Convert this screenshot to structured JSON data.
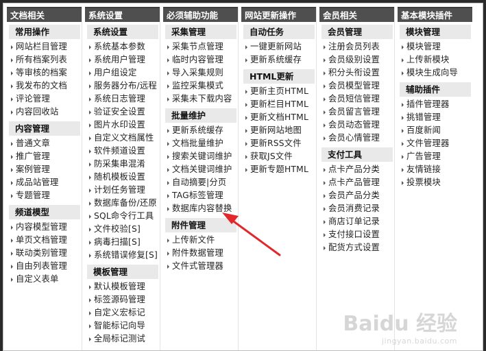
{
  "columns": [
    {
      "header": "文档相关",
      "groups": [
        {
          "title": "常用操作",
          "items": [
            "网站栏目管理",
            "所有档案列表",
            "等审核的档案",
            "我发布的文档",
            "评论管理",
            "内容回收站"
          ]
        },
        {
          "title": "内容管理",
          "items": [
            "普通文章",
            "推广管理",
            "案例管理",
            "成品站管理",
            "专题管理"
          ]
        },
        {
          "title": "频道模型",
          "items": [
            "内容模型管理",
            "单页文档管理",
            "联动类别管理",
            "自由列表管理",
            "自定义表单"
          ]
        }
      ]
    },
    {
      "header": "系统设置",
      "groups": [
        {
          "title": "系统设置",
          "items": [
            "系统基本参数",
            "系统用户管理",
            "用户组设定",
            "服务器分布/远程",
            "系统日志管理",
            "验证安全设置",
            "图片水印设置",
            "自定义文档属性",
            "软件频道设置",
            "防采集串混淆",
            "随机模板设置",
            "计划任务管理",
            "数据库备份/还原",
            "SQL命令行工具",
            "文件校验[S]",
            "病毒扫描[S]",
            "系统错误修复[S]"
          ]
        },
        {
          "title": "模板管理",
          "items": [
            "默认模板管理",
            "标签源码管理",
            "自定义宏标记",
            "智能标记向导",
            "全局标记测试"
          ]
        }
      ]
    },
    {
      "header": "必须辅助功能",
      "groups": [
        {
          "title": "采集管理",
          "items": [
            "采集节点管理",
            "临时内容管理",
            "导入采集规则",
            "监控采集模式",
            "采集未下载内容"
          ]
        },
        {
          "title": "批量维护",
          "items": [
            "更新系统缓存",
            "文档批量维护",
            "搜索关键词维护",
            "文档关键词维护",
            "自动摘要|分页",
            "TAG标签管理",
            "数据库内容替换"
          ]
        },
        {
          "title": "附件管理",
          "items": [
            "上传新文件",
            "附件数据管理",
            "文件式管理器"
          ]
        }
      ]
    },
    {
      "header": "网站更新操作",
      "groups": [
        {
          "title": "自动任务",
          "items": [
            "一键更新网站",
            "更新系统缓存"
          ]
        },
        {
          "title": "HTML更新",
          "items": [
            "更新主页HTML",
            "更新栏目HTML",
            "更新文档HTML",
            "更新网站地图",
            "更新RSS文件",
            "获取JS文件",
            "更新专题HTML"
          ]
        }
      ]
    },
    {
      "header": "会员相关",
      "groups": [
        {
          "title": "会员管理",
          "items": [
            "注册会员列表",
            "会员级别设置",
            "积分头衔设置",
            "会员模型管理",
            "会员短信管理",
            "会员留言管理",
            "会员动态管理",
            "会员心情管理"
          ]
        },
        {
          "title": "支付工具",
          "items": [
            "点卡产品分类",
            "点卡产品管理",
            "会员产品分类",
            "会员消费记录",
            "商店订单记录",
            "支付接口设置",
            "配货方式设置"
          ]
        }
      ]
    },
    {
      "header": "基本模块插件",
      "groups": [
        {
          "title": "模块管理",
          "items": [
            "模块管理",
            "上传新模块",
            "模块生成向导"
          ]
        },
        {
          "title": "辅助插件",
          "items": [
            "插件管理器",
            "挑错管理",
            "百度新闻",
            "文件管理器",
            "广告管理",
            "友情链接",
            "投票模块"
          ]
        }
      ]
    }
  ],
  "watermark": {
    "brand": "Baidu 经验",
    "url": "jingyan.baidu.com"
  },
  "colors": {
    "header_bg": "#4f4f4f",
    "group_bg": "#e9e9e9",
    "arrow": "#e3262a"
  }
}
